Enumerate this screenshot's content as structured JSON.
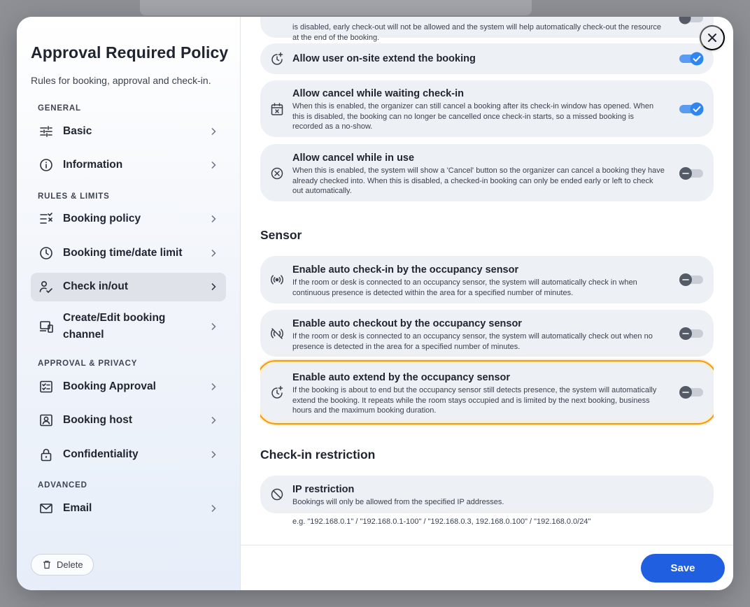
{
  "sidebar": {
    "title": "Approval Required Policy",
    "subtitle": "Rules for booking, approval and check-in.",
    "sections": {
      "general": "GENERAL",
      "rules": "RULES & LIMITS",
      "approval": "APPROVAL & PRIVACY",
      "advanced": "ADVANCED"
    },
    "items": {
      "basic": "Basic",
      "information": "Information",
      "booking_policy": "Booking policy",
      "time_limit": "Booking time/date limit",
      "check_in_out": "Check in/out",
      "create_edit": "Create/Edit booking channel",
      "booking_approval": "Booking Approval",
      "booking_host": "Booking host",
      "confidentiality": "Confidentiality",
      "email": "Email"
    },
    "delete_label": "Delete"
  },
  "cards": {
    "top_partial": {
      "desc": "is disabled, early check-out will not be allowed and the system will help automatically check-out the resource at the end of the booking."
    },
    "extend_onsite": {
      "title": "Allow user on-site extend the booking",
      "enabled": true
    },
    "cancel_waiting": {
      "title": "Allow cancel while waiting check-in",
      "desc": "When this is enabled, the organizer can still cancel a booking after its check-in window has opened. When this is disabled, the booking can no longer be cancelled once check-in starts, so a missed booking is recorded as a no-show.",
      "enabled": true
    },
    "cancel_in_use": {
      "title": "Allow cancel while in use",
      "desc": "When this is enabled, the system will show a 'Cancel' button so the organizer can cancel a booking they have already checked into. When this is disabled, a checked-in booking can only be ended early or left to check out automatically.",
      "enabled": false
    },
    "auto_checkin": {
      "title": "Enable auto check-in by the occupancy sensor",
      "desc": "If the room or desk is connected to an occupancy sensor, the system will automatically check in when continuous presence is detected within the area for a specified number of minutes.",
      "enabled": false
    },
    "auto_checkout": {
      "title": "Enable auto checkout by the occupancy sensor",
      "desc": "If the room or desk is connected to an occupancy sensor, the system will automatically check out when no presence is detected in the area for a specified number of minutes.",
      "enabled": false
    },
    "auto_extend": {
      "title": "Enable auto extend by the occupancy sensor",
      "desc": "If the booking is about to end but the occupancy sensor still detects presence, the system will automatically extend the booking. It repeats while the room stays occupied and is limited by the next booking, business hours and the maximum booking duration.",
      "enabled": false
    },
    "ip_restriction": {
      "title": "IP restriction",
      "desc": "Bookings will only be allowed from the specified IP addresses."
    }
  },
  "headings": {
    "sensor": "Sensor",
    "checkin_restriction": "Check-in restriction"
  },
  "ip_hint": "e.g. \"192.168.0.1\" / \"192.168.0.1-100\" / \"192.168.0.3, 192.168.0.100\" / \"192.168.0.0/24\"",
  "footer": {
    "save_label": "Save"
  },
  "colors": {
    "accent": "#1f5fe0",
    "toggle_on": "#2f86f0",
    "highlight": "#f29d0a"
  }
}
